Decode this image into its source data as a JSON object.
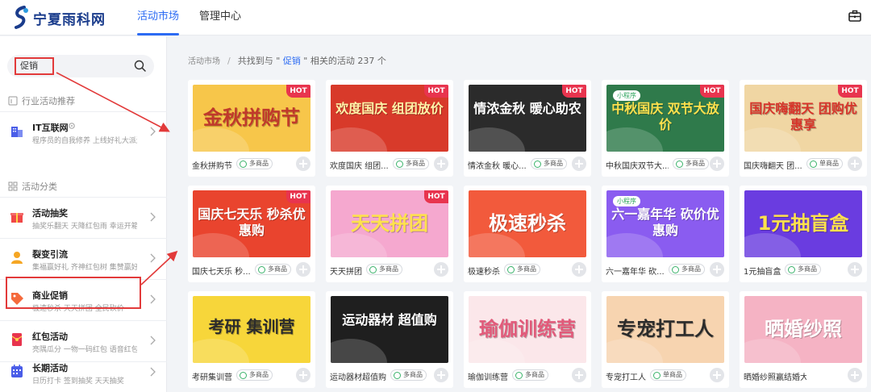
{
  "header": {
    "logo_text": "宁夏雨科网",
    "nav": [
      "活动市场",
      "管理中心"
    ],
    "tool_icon": "briefcase-icon"
  },
  "sidebar": {
    "search": {
      "value": "促销",
      "icon": "search-icon"
    },
    "section_recommend": "行业活动推荐",
    "recommend_item": {
      "title": "IT互联网",
      "subtitle": "程序员的自我修养  上线好礼大派送"
    },
    "section_category": "活动分类",
    "categories": [
      {
        "title": "活动抽奖",
        "subtitle": "抽奖乐翻天   天降红包雨   幸运开箱",
        "icon": "gift-icon",
        "color": "#f04848"
      },
      {
        "title": "裂变引流",
        "subtitle": "集福赢好礼   齐神红包树   集赞赢好礼",
        "icon": "user-icon",
        "color": "#f5a623"
      },
      {
        "title": "商业促销",
        "subtitle": "极速秒杀   天天拼团   全民砍价",
        "icon": "tag-icon",
        "color": "#f56a3c"
      },
      {
        "title": "红包活动",
        "subtitle": "亮隅瓜分   一物一码红包   语音红包",
        "icon": "red-envelope-icon",
        "color": "#e8344e"
      },
      {
        "title": "长期活动",
        "subtitle": "日历打卡   签到抽奖   天天抽奖",
        "icon": "calendar-icon",
        "color": "#4a5de8"
      }
    ]
  },
  "breadcrumb": {
    "root": "活动市场",
    "separator": "/",
    "prefix": "共找到与 \" ",
    "keyword": "促销",
    "suffix": " \" 相关的活动 237 个"
  },
  "labels": {
    "hot": "HOT",
    "mini_program": "小程序"
  },
  "cards": [
    {
      "title": "金秋拼购节",
      "tag": "多商品",
      "poster_text": "金秋拼购节",
      "bg": "#f7c64a",
      "fg": "#c0392b",
      "hot": true
    },
    {
      "title": "欢度国庆 组团...",
      "tag": "多商品",
      "poster_text": "欢度国庆 组团放价",
      "bg": "#d83a2a",
      "fg": "#fff3a8",
      "hot": true
    },
    {
      "title": "情浓金秋 暖心...",
      "tag": "多商品",
      "poster_text": "情浓金秋 暖心助农",
      "bg": "#2b2b2b",
      "fg": "#ffffff",
      "hot": true
    },
    {
      "title": "中秋国庆双节大...",
      "tag": "多商品",
      "poster_text": "中秋国庆 双节大放价",
      "bg": "#2f7a4b",
      "fg": "#ffe14d",
      "hot": true,
      "mini": true
    },
    {
      "title": "国庆嗨翻天 团...",
      "tag": "单商品",
      "poster_text": "国庆嗨翻天 团购优惠享",
      "bg": "#f0d6a3",
      "fg": "#d8342a",
      "hot": true
    },
    {
      "title": "国庆七天乐 秒...",
      "tag": "多商品",
      "poster_text": "国庆七天乐 秒杀优惠购",
      "bg": "#e9442e",
      "fg": "#ffffff",
      "hot": true
    },
    {
      "title": "天天拼团",
      "tag": "多商品",
      "poster_text": "天天拼团",
      "bg": "#f5a8cf",
      "fg": "#ffe14d",
      "hot": true
    },
    {
      "title": "极速秒杀",
      "tag": "多商品",
      "poster_text": "极速秒杀",
      "bg": "#f25a3c",
      "fg": "#ffffff",
      "hot": false
    },
    {
      "title": "六一嘉年华 砍...",
      "tag": "多商品",
      "poster_text": "六一嘉年华 砍价优惠购",
      "bg": "#8a5cf0",
      "fg": "#ffffff",
      "hot": false,
      "mini": true
    },
    {
      "title": "1元抽盲盒",
      "tag": "多商品",
      "poster_text": "1元抽盲盒",
      "bg": "#6a3ce0",
      "fg": "#ffe14d",
      "hot": false
    },
    {
      "title": "考研集训营",
      "tag": "多商品",
      "poster_text": "考研 集训营",
      "bg": "#f7d63a",
      "fg": "#2b2b2b",
      "hot": false
    },
    {
      "title": "运动器材超值购",
      "tag": "多商品",
      "poster_text": "运动器材 超值购",
      "bg": "#1f1f1f",
      "fg": "#ffffff",
      "hot": false
    },
    {
      "title": "瑜伽训练营",
      "tag": "多商品",
      "poster_text": "瑜伽训练营",
      "bg": "#fbe7ea",
      "fg": "#e25a7a",
      "hot": false
    },
    {
      "title": "专宠打工人",
      "tag": "单商品",
      "poster_text": "专宠打工人",
      "bg": "#f7d4b0",
      "fg": "#2b2b2b",
      "hot": false
    },
    {
      "title": "晒婚纱照赢结婚大礼",
      "tag": "",
      "poster_text": "晒婚纱照",
      "bg": "#f5b3c4",
      "fg": "#ffffff",
      "hot": false
    }
  ]
}
